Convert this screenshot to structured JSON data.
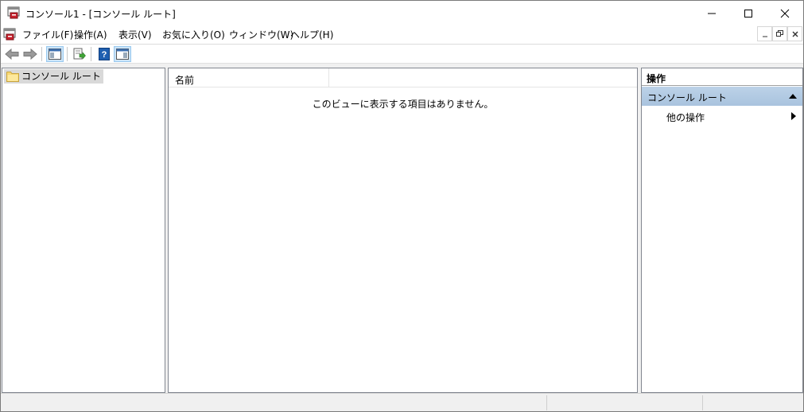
{
  "window": {
    "title": "コンソール1 - [コンソール ルート]"
  },
  "menubar": {
    "items": [
      {
        "label": "ファイル(F)"
      },
      {
        "label": "操作(A)"
      },
      {
        "label": "表示(V)"
      },
      {
        "label": "お気に入り(O)"
      },
      {
        "label": "ウィンドウ(W)"
      },
      {
        "label": "ヘルプ(H)"
      }
    ]
  },
  "tree": {
    "root_label": "コンソール ルート"
  },
  "results": {
    "column_name": "名前",
    "empty_message": "このビューに表示する項目はありません。"
  },
  "actions": {
    "header": "操作",
    "section_title": "コンソール ルート",
    "more_actions": "他の操作"
  },
  "colors": {
    "accent_section": "#bcd2e8",
    "pressed_button": "#cce4f7",
    "help_icon": "#1f5fb0"
  }
}
